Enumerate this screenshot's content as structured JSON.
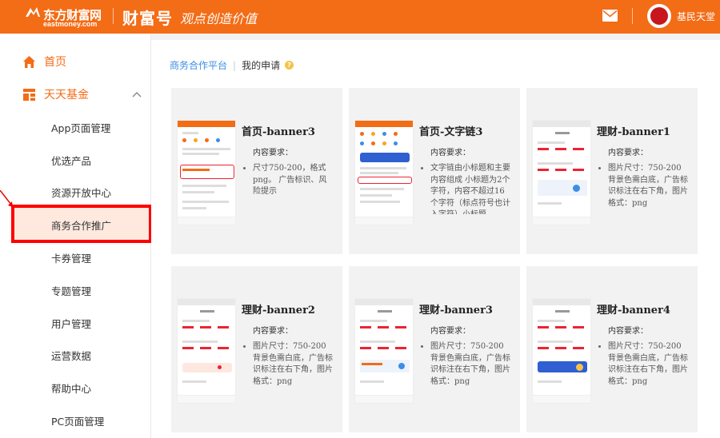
{
  "header": {
    "logo_cn": "东方财富网",
    "logo_en": "eastmoney.com",
    "brand": "财富号",
    "slogan": "观点创造价值",
    "mail_icon": "mail-icon",
    "username": "基民天堂",
    "colors": {
      "bar": "#f36c16"
    }
  },
  "sidebar": {
    "home": "首页",
    "section": "天天基金",
    "items": [
      "App页面管理",
      "优选产品",
      "资源开放中心",
      "商务合作推广",
      "卡券管理",
      "专题管理",
      "用户管理",
      "运营数据",
      "帮助中心",
      "PC页面管理"
    ],
    "active_index": 3
  },
  "breadcrumb": {
    "root": "商务合作平台",
    "current": "我的申请"
  },
  "cards": [
    {
      "title": "首页-banner3",
      "req_label": "内容要求：",
      "desc": "尺寸750-200，格式png。 广告标识、风险提示"
    },
    {
      "title": "首页-文字链3",
      "req_label": "内容要求：",
      "desc": "文字链由小标题和主要内容组成 小标题为2个字符，内容不超过16个字符（标点符号也计入字符）小标题..."
    },
    {
      "title": "理财-banner1",
      "req_label": "内容要求：",
      "desc": "图片尺寸：750-200 背景色需白底，广告标识标注在右下角，图片格式：png"
    },
    {
      "title": "理财-banner2",
      "req_label": "内容要求：",
      "desc": "图片尺寸：750-200 背景色需白底，广告标识标注在右下角，图片格式：png"
    },
    {
      "title": "理财-banner3",
      "req_label": "内容要求：",
      "desc": "图片尺寸：750-200 背景色需白底，广告标识标注在右下角，图片格式：png"
    },
    {
      "title": "理财-banner4",
      "req_label": "内容要求：",
      "desc": "图片尺寸：750-200 背景色需白底，广告标识标注在右下角，图片格式：png"
    }
  ]
}
